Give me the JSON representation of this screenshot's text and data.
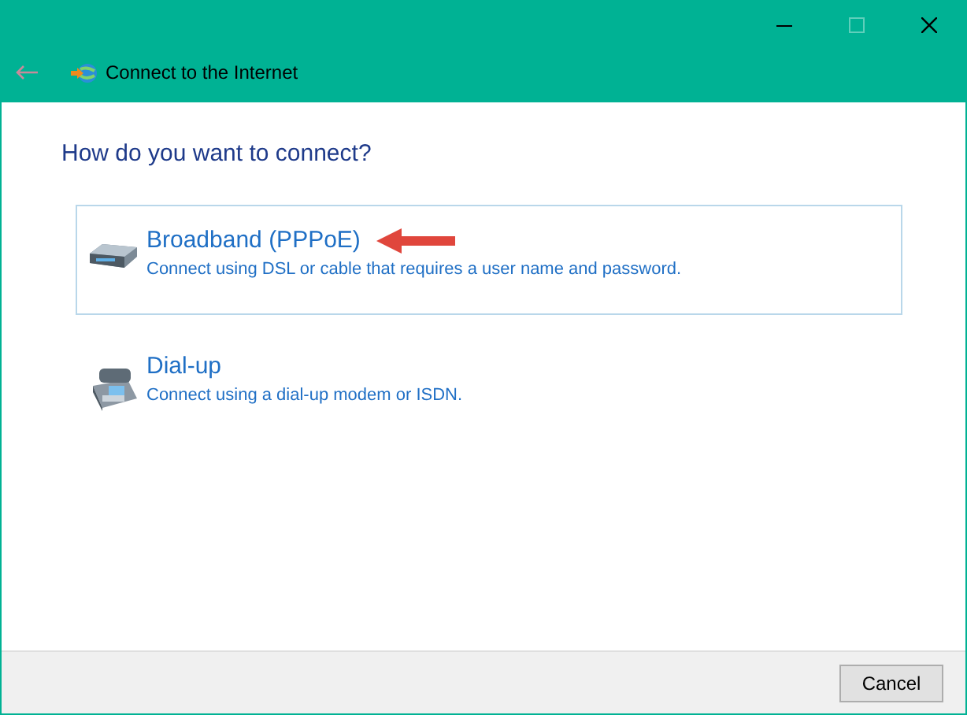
{
  "window": {
    "title": "Connect to the Internet",
    "back_disabled": true,
    "maximize_disabled": true
  },
  "heading": "How do you want to connect?",
  "options": [
    {
      "kind": "broadband",
      "title": "Broadband (PPPoE)",
      "description": "Connect using DSL or cable that requires a user name and password.",
      "selected": true,
      "annotated": true
    },
    {
      "kind": "dialup",
      "title": "Dial-up",
      "description": "Connect using a dial-up modem or ISDN.",
      "selected": false,
      "annotated": false
    }
  ],
  "buttons": [
    "Cancel"
  ]
}
